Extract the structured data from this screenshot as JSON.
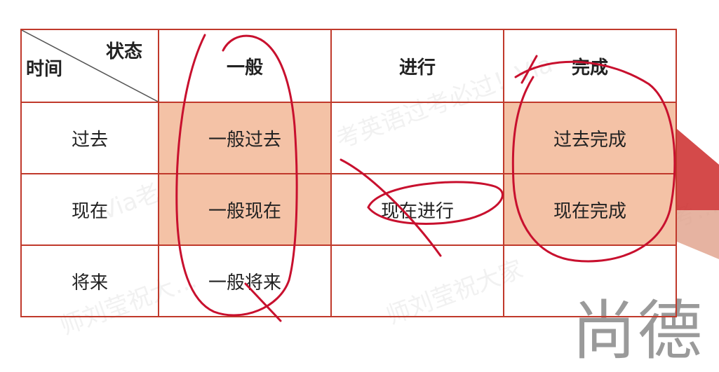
{
  "watermarks": [
    "考英语过考必过！Via",
    "Via老师",
    "师刘莹祝大…",
    "师刘莹祝大家",
    "考…"
  ],
  "brand_text": "尚德",
  "table": {
    "corner": {
      "state": "状态",
      "time": "时间"
    },
    "columns": [
      "一般",
      "进行",
      "完成"
    ],
    "rows": [
      {
        "time": "过去",
        "cells": [
          "一般过去",
          "",
          "过去完成"
        ]
      },
      {
        "time": "现在",
        "cells": [
          "一般现在",
          "现在进行",
          "现在完成"
        ]
      },
      {
        "time": "将来",
        "cells": [
          "一般将来",
          "",
          ""
        ]
      }
    ]
  },
  "colors": {
    "border": "#c0392b",
    "highlight": "#f4c2a6",
    "time_label": "#c0392b",
    "ink": "#c8102e"
  }
}
